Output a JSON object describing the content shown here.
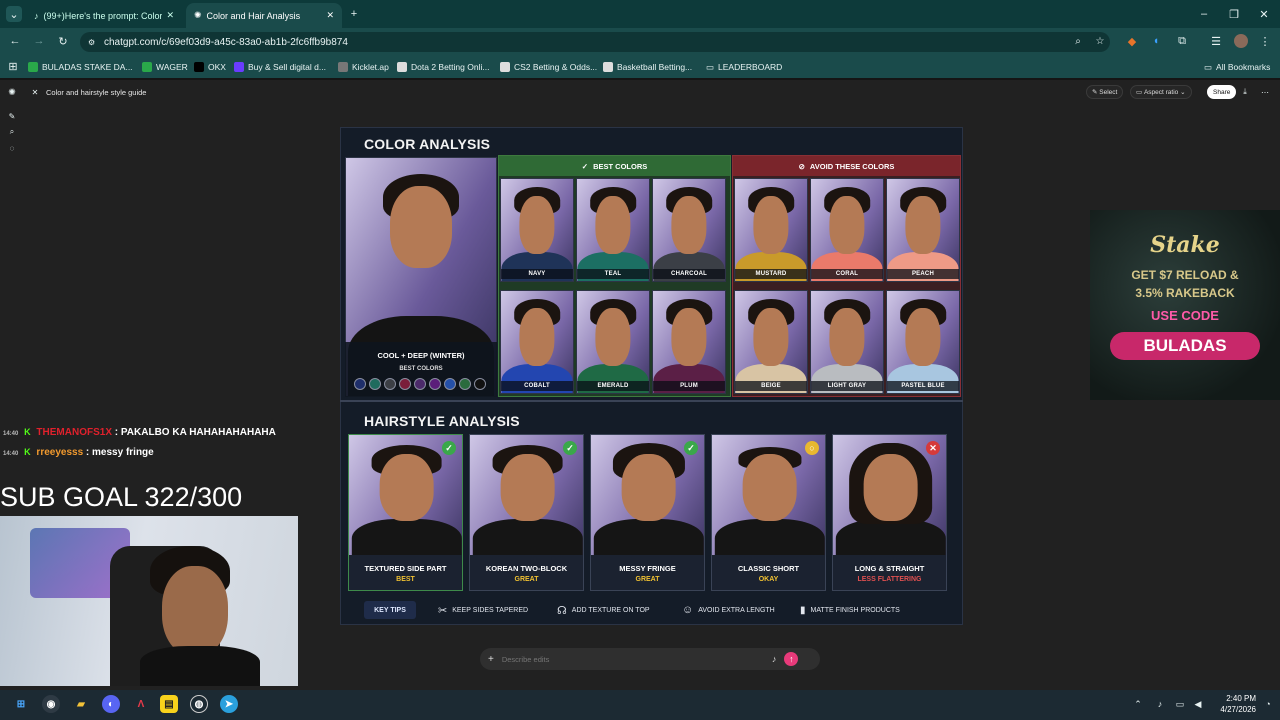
{
  "browser": {
    "tabs": [
      {
        "label": "(99+)Here's the prompt: Color a"
      },
      {
        "label": "Color and Hair Analysis"
      }
    ],
    "url": "chatgpt.com/c/69ef03d9-a45c-83a0-ab1b-2fc6ffb9b874",
    "bookmarks": [
      "BULADAS STAKE DA...",
      "WAGER",
      "OKX",
      "Buy & Sell digital d...",
      "Kicklet.ap",
      "Dota 2 Betting Onli...",
      "CS2 Betting & Odds...",
      "Basketball Betting...",
      "LEADERBOARD"
    ],
    "all_bookmarks": "All Bookmarks"
  },
  "chat_header": {
    "title": "Color and hairstyle style guide",
    "select": "Select",
    "aspect": "Aspect ratio",
    "share": "Share"
  },
  "color_analysis": {
    "title": "COLOR ANALYSIS",
    "season": "COOL + DEEP (WINTER)",
    "best_label": "BEST COLORS",
    "palette": [
      "#1e2e6a",
      "#1f6b5e",
      "#3c3f45",
      "#7a1e3a",
      "#4b2a6a",
      "#5b1e7a",
      "#2450a8",
      "#2a6b3e",
      "#111111"
    ],
    "best_header": "BEST COLORS",
    "avoid_header": "AVOID THESE COLORS",
    "best": [
      {
        "name": "NAVY",
        "color": "#1f3358"
      },
      {
        "name": "TEAL",
        "color": "#1c6f63"
      },
      {
        "name": "CHARCOAL",
        "color": "#3b3f46"
      },
      {
        "name": "COBALT",
        "color": "#2346b0"
      },
      {
        "name": "EMERALD",
        "color": "#1f6a45"
      },
      {
        "name": "PLUM",
        "color": "#5b1f46"
      }
    ],
    "avoid": [
      {
        "name": "MUSTARD",
        "color": "#c99a2a"
      },
      {
        "name": "CORAL",
        "color": "#ea7a6a"
      },
      {
        "name": "PEACH",
        "color": "#ef9a86"
      },
      {
        "name": "BEIGE",
        "color": "#d8c4a4"
      },
      {
        "name": "LIGHT GRAY",
        "color": "#b9bcc0"
      },
      {
        "name": "PASTEL BLUE",
        "color": "#a8c6e0"
      }
    ]
  },
  "hairstyle_analysis": {
    "title": "HAIRSTYLE ANALYSIS",
    "styles": [
      {
        "name": "TEXTURED SIDE PART",
        "rating": "BEST",
        "rating_color": "#f1c232",
        "status": "check"
      },
      {
        "name": "KOREAN TWO-BLOCK",
        "rating": "GREAT",
        "rating_color": "#f1c232",
        "status": "check"
      },
      {
        "name": "MESSY FRINGE",
        "rating": "GREAT",
        "rating_color": "#f1c232",
        "status": "check"
      },
      {
        "name": "CLASSIC SHORT",
        "rating": "OKAY",
        "rating_color": "#f1c232",
        "status": "neutral"
      },
      {
        "name": "LONG & STRAIGHT",
        "rating": "LESS FLATTERING",
        "rating_color": "#e05050",
        "status": "cross"
      }
    ],
    "key_tips_label": "KEY TIPS",
    "tips": [
      "KEEP SIDES TAPERED",
      "ADD TEXTURE ON TOP",
      "AVOID EXTRA LENGTH",
      "MATTE FINISH PRODUCTS"
    ]
  },
  "composer": {
    "placeholder": "Describe edits"
  },
  "stream": {
    "chat": [
      {
        "time": "14:40",
        "user": "THEMANOFS1X",
        "sep": " : ",
        "text": "PAKALBO KA HAHAHAHAHAHA",
        "color": "#e0212c"
      },
      {
        "time": "14:40",
        "user": "rreeyesss",
        "sep": " : ",
        "text": "messy fringe",
        "color": "#f29a2e"
      }
    ],
    "sub_goal": "SUB GOAL 322/300",
    "ad": {
      "brand": "Stake",
      "line1": "GET $7 RELOAD &",
      "line2": "3.5% RAKEBACK",
      "line3": "USE CODE",
      "code": "BULADAS"
    }
  },
  "taskbar": {
    "time": "2:40 PM",
    "date": "4/27/2026"
  }
}
